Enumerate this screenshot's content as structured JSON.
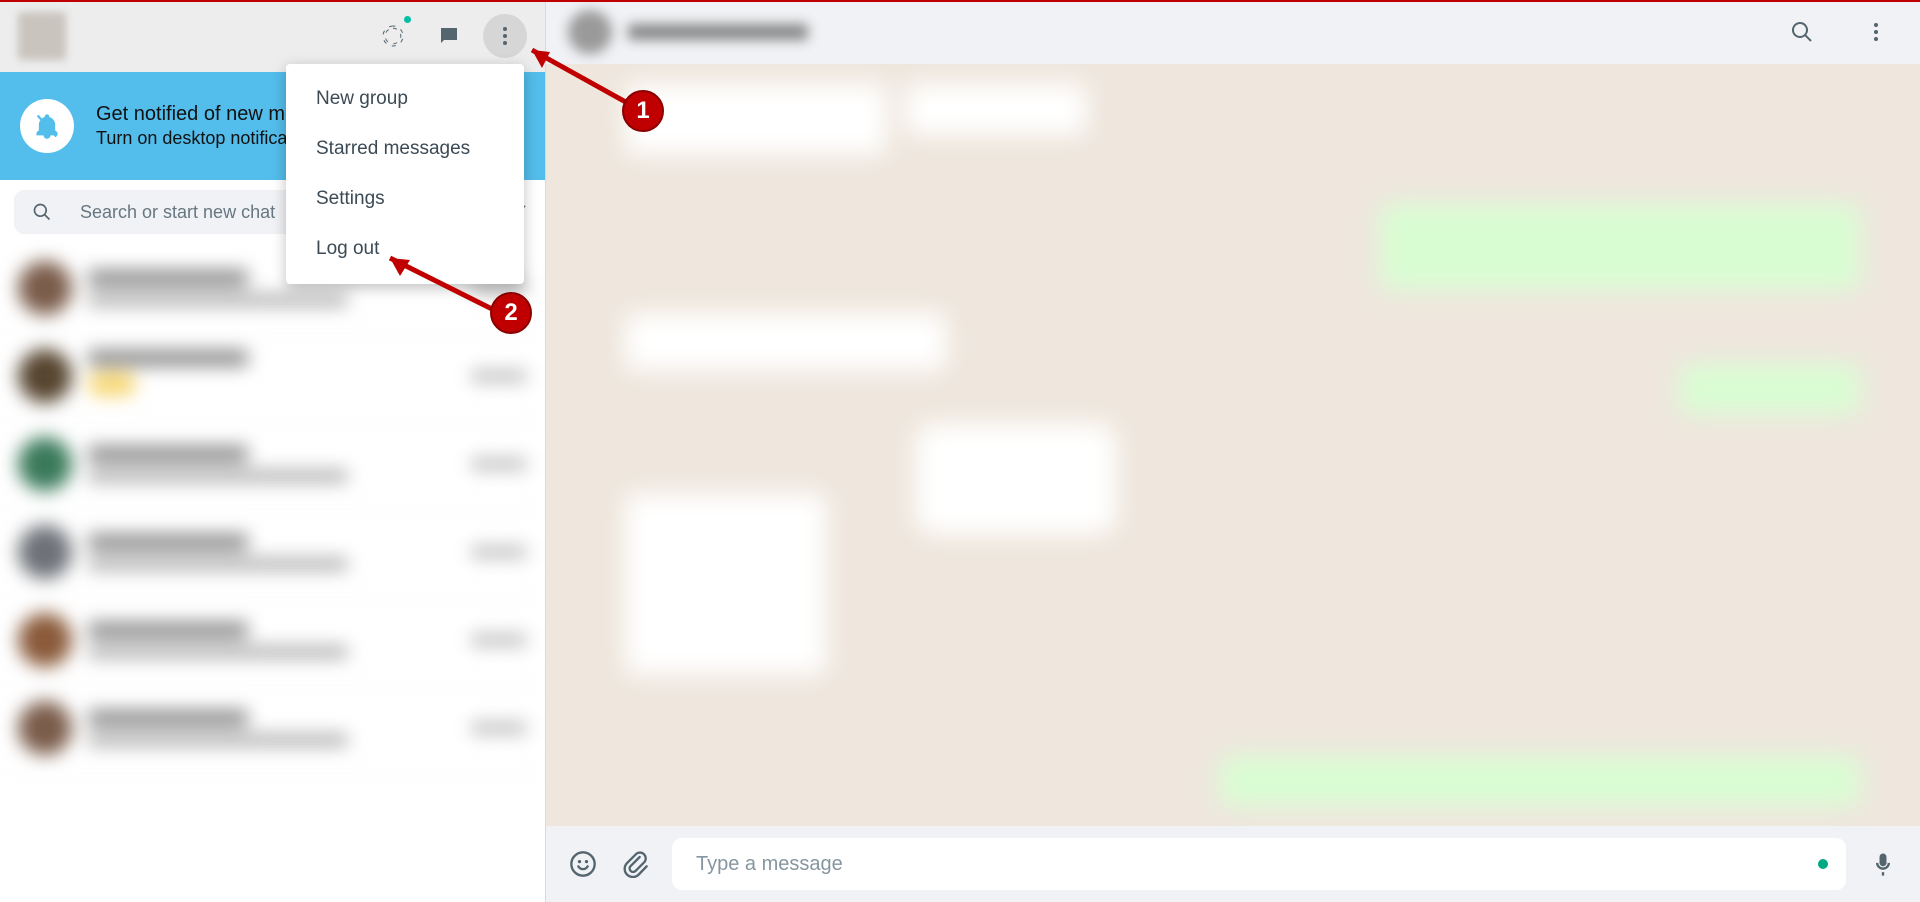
{
  "sidebar": {
    "notification": {
      "title": "Get notified of new messages",
      "subtitle": "Turn on desktop notifications"
    },
    "search_placeholder": "Search or start new chat"
  },
  "menu": {
    "items": [
      "New group",
      "Starred messages",
      "Settings",
      "Log out"
    ]
  },
  "composer": {
    "placeholder": "Type a message"
  },
  "annotations": {
    "badge1": "1",
    "badge2": "2"
  }
}
